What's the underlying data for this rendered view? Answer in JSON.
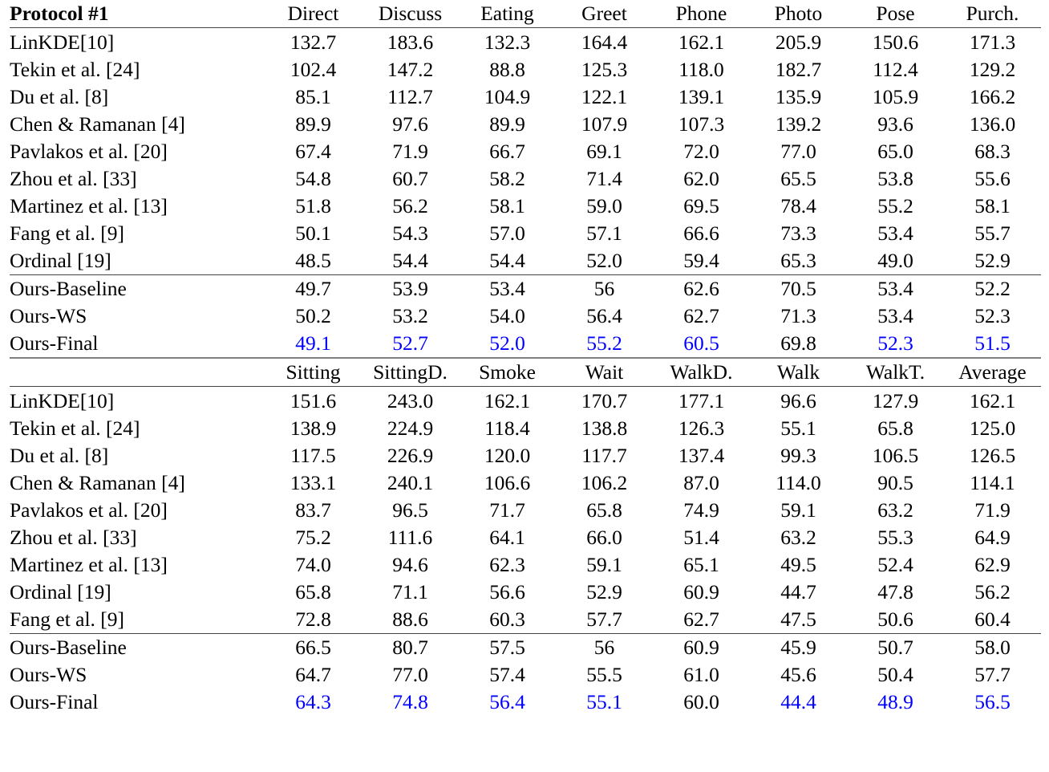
{
  "table": {
    "title": "Protocol #1",
    "accent_blue": "#0000FF",
    "rule_color": "#808080",
    "block1": {
      "header": {
        "label": "Protocol #1",
        "columns": [
          "Direct",
          "Discuss",
          "Eating",
          "Greet",
          "Phone",
          "Photo",
          "Pose",
          "Purch."
        ]
      },
      "rows": [
        {
          "label": "LinKDE[10]",
          "values": [
            "132.7",
            "183.6",
            "132.3",
            "164.4",
            "162.1",
            "205.9",
            "150.6",
            "171.3"
          ],
          "styles": [
            "",
            "",
            "",
            "",
            "",
            "",
            "",
            ""
          ]
        },
        {
          "label": "Tekin et al. [24]",
          "values": [
            "102.4",
            "147.2",
            "88.8",
            "125.3",
            "118.0",
            "182.7",
            "112.4",
            "129.2"
          ],
          "styles": [
            "",
            "",
            "",
            "",
            "",
            "",
            "",
            ""
          ]
        },
        {
          "label": "Du et al. [8]",
          "values": [
            "85.1",
            "112.7",
            "104.9",
            "122.1",
            "139.1",
            "135.9",
            "105.9",
            "166.2"
          ],
          "styles": [
            "",
            "",
            "",
            "",
            "",
            "",
            "",
            ""
          ]
        },
        {
          "label": "Chen & Ramanan [4]",
          "values": [
            "89.9",
            "97.6",
            "89.9",
            "107.9",
            "107.3",
            "139.2",
            "93.6",
            "136.0"
          ],
          "styles": [
            "",
            "",
            "",
            "",
            "",
            "",
            "",
            ""
          ]
        },
        {
          "label": "Pavlakos et al. [20]",
          "values": [
            "67.4",
            "71.9",
            "66.7",
            "69.1",
            "72.0",
            "77.0",
            "65.0",
            "68.3"
          ],
          "styles": [
            "",
            "",
            "",
            "",
            "",
            "",
            "",
            ""
          ]
        },
        {
          "label": "Zhou et al. [33]",
          "values": [
            "54.8",
            "60.7",
            "58.2",
            "71.4",
            "62.0",
            "65.5",
            "53.8",
            "55.6"
          ],
          "styles": [
            "",
            "",
            "",
            "",
            "",
            "b",
            "",
            ""
          ]
        },
        {
          "label": "Martinez et al. [13]",
          "values": [
            "51.8",
            "56.2",
            "58.1",
            "59.0",
            "69.5",
            "78.4",
            "55.2",
            "58.1"
          ],
          "styles": [
            "",
            "",
            "",
            "",
            "",
            "",
            "",
            ""
          ]
        },
        {
          "label": "Fang et al. [9]",
          "values": [
            "50.1",
            "54.3",
            "57.0",
            "57.1",
            "66.6",
            "73.3",
            "53.4",
            "55.7"
          ],
          "styles": [
            "",
            "",
            "",
            "",
            "",
            "",
            "",
            ""
          ]
        },
        {
          "label": "Ordinal [19]",
          "values": [
            "48.5",
            "54.4",
            "54.4",
            "52.0",
            "59.4",
            "65.3",
            "49.0",
            "52.9"
          ],
          "styles": [
            "b",
            "",
            "",
            "",
            "b",
            "b",
            "b",
            ""
          ]
        }
      ],
      "ours_rows": [
        {
          "label": "Ours-Baseline",
          "values": [
            "49.7",
            "53.9",
            "53.4",
            "56",
            "62.6",
            "70.5",
            "53.4",
            "52.2"
          ],
          "styles": [
            "",
            "",
            "",
            "",
            "",
            "",
            "",
            ""
          ]
        },
        {
          "label": "Ours-WS",
          "values": [
            "50.2",
            "53.2",
            "54.0",
            "56.4",
            "62.7",
            "71.3",
            "53.4",
            "52.3"
          ],
          "styles": [
            "",
            "",
            "",
            "",
            "",
            "",
            "",
            ""
          ]
        },
        {
          "label": "Ours-Final",
          "values": [
            "49.1",
            "52.7",
            "52.0",
            "55.2",
            "60.5",
            "69.8",
            "52.3",
            "51.5"
          ],
          "styles": [
            "blu",
            "blu",
            "blu",
            "blu",
            "blu",
            "",
            "blu",
            "blu"
          ]
        }
      ]
    },
    "block2": {
      "header": {
        "label": "",
        "columns": [
          "Sitting",
          "SittingD.",
          "Smoke",
          "Wait",
          "WalkD.",
          "Walk",
          "WalkT.",
          "Average"
        ]
      },
      "rows": [
        {
          "label": "LinKDE[10]",
          "values": [
            "151.6",
            "243.0",
            "162.1",
            "170.7",
            "177.1",
            "96.6",
            "127.9",
            "162.1"
          ],
          "styles": [
            "",
            "",
            "",
            "",
            "",
            "",
            "",
            ""
          ]
        },
        {
          "label": "Tekin et al. [24]",
          "values": [
            "138.9",
            "224.9",
            "118.4",
            "138.8",
            "126.3",
            "55.1",
            "65.8",
            "125.0"
          ],
          "styles": [
            "",
            "",
            "",
            "",
            "",
            "",
            "",
            ""
          ]
        },
        {
          "label": "Du et al. [8]",
          "values": [
            "117.5",
            "226.9",
            "120.0",
            "117.7",
            "137.4",
            "99.3",
            "106.5",
            "126.5"
          ],
          "styles": [
            "",
            "",
            "",
            "",
            "",
            "",
            "",
            ""
          ]
        },
        {
          "label": "Chen & Ramanan [4]",
          "values": [
            "133.1",
            "240.1",
            "106.6",
            "106.2",
            "87.0",
            "114.0",
            "90.5",
            "114.1"
          ],
          "styles": [
            "",
            "",
            "",
            "",
            "",
            "",
            "",
            ""
          ]
        },
        {
          "label": "Pavlakos et al. [20]",
          "values": [
            "83.7",
            "96.5",
            "71.7",
            "65.8",
            "74.9",
            "59.1",
            "63.2",
            "71.9"
          ],
          "styles": [
            "",
            "",
            "",
            "",
            "",
            "",
            "",
            ""
          ]
        },
        {
          "label": "Zhou et al. [33]",
          "values": [
            "75.2",
            "111.6",
            "64.1",
            "66.0",
            "51.4",
            "63.2",
            "55.3",
            "64.9"
          ],
          "styles": [
            "",
            "",
            "",
            "",
            "b",
            "",
            "",
            ""
          ]
        },
        {
          "label": "Martinez et al. [13]",
          "values": [
            "74.0",
            "94.6",
            "62.3",
            "59.1",
            "65.1",
            "49.5",
            "52.4",
            "62.9"
          ],
          "styles": [
            "",
            "",
            "",
            "",
            "",
            "",
            "",
            ""
          ]
        },
        {
          "label": "Ordinal [19]",
          "values": [
            "65.8",
            "71.1",
            "56.6",
            "52.9",
            "60.9",
            "44.7",
            "47.8",
            "56.2"
          ],
          "styles": [
            "",
            "b",
            "",
            "b",
            "",
            "",
            "b",
            "b"
          ]
        },
        {
          "label": "Fang et al. [9]",
          "values": [
            "72.8",
            "88.6",
            "60.3",
            "57.7",
            "62.7",
            "47.5",
            "50.6",
            "60.4"
          ],
          "styles": [
            "",
            "",
            "",
            "",
            "",
            "",
            "",
            ""
          ]
        }
      ],
      "ours_rows": [
        {
          "label": "Ours-Baseline",
          "values": [
            "66.5",
            "80.7",
            "57.5",
            "56",
            "60.9",
            "45.9",
            "50.7",
            "58.0"
          ],
          "styles": [
            "",
            "",
            "",
            "",
            "",
            "",
            "",
            ""
          ]
        },
        {
          "label": "Ours-WS",
          "values": [
            "64.7",
            "77.0",
            "57.4",
            "55.5",
            "61.0",
            "45.6",
            "50.4",
            "57.7"
          ],
          "styles": [
            "",
            "",
            "",
            "",
            "",
            "",
            "",
            ""
          ]
        },
        {
          "label": "Ours-Final",
          "values": [
            "64.3",
            "74.8",
            "56.4",
            "55.1",
            "60.0",
            "44.4",
            "48.9",
            "56.5"
          ],
          "styles": [
            "blu",
            "blu",
            "blu",
            "blu",
            "",
            "blu",
            "blu",
            "blu"
          ]
        }
      ]
    }
  }
}
